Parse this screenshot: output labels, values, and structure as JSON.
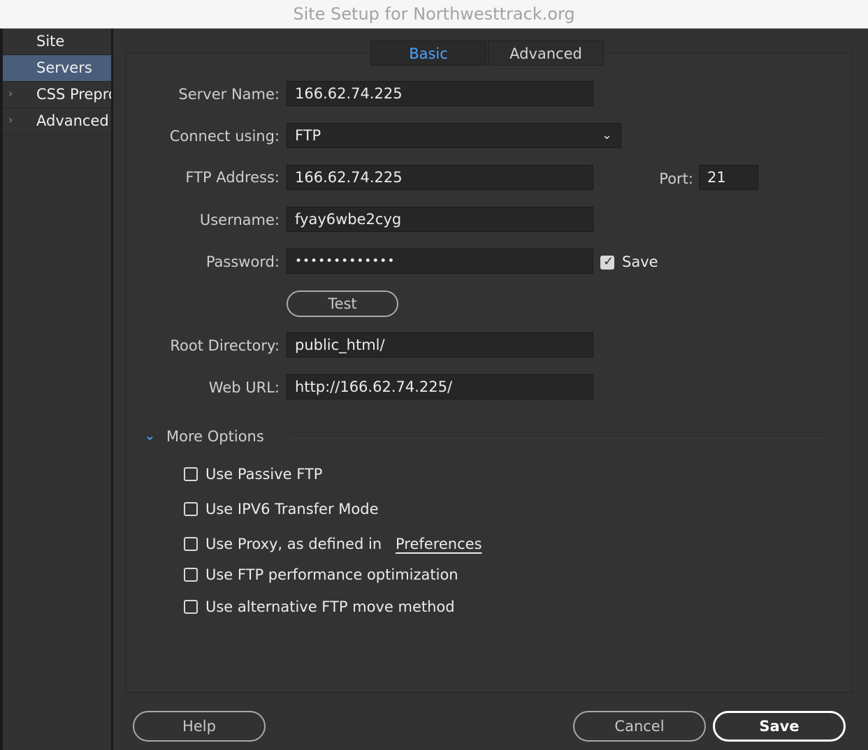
{
  "window": {
    "title": "Site Setup for Northwesttrack.org"
  },
  "sidebar": {
    "items": [
      {
        "label": "Site",
        "selected": false,
        "expandable": false
      },
      {
        "label": "Servers",
        "selected": true,
        "expandable": false
      },
      {
        "label": "CSS Prepro",
        "selected": false,
        "expandable": true
      },
      {
        "label": "Advanced",
        "selected": false,
        "expandable": true
      }
    ]
  },
  "tabs": [
    {
      "label": "Basic",
      "active": true
    },
    {
      "label": "Advanced",
      "active": false
    }
  ],
  "form": {
    "server_name": {
      "label": "Server Name:",
      "value": "166.62.74.225"
    },
    "connect_using": {
      "label": "Connect using:",
      "value": "FTP"
    },
    "ftp_address": {
      "label": "FTP Address:",
      "value": "166.62.74.225"
    },
    "port": {
      "label": "Port:",
      "value": "21"
    },
    "username": {
      "label": "Username:",
      "value": "fyay6wbe2cyg"
    },
    "password": {
      "label": "Password:",
      "value": "•••••••••••••",
      "save_label": "Save",
      "save_checked": true
    },
    "test_button": "Test",
    "root_directory": {
      "label": "Root Directory:",
      "value": "public_html/"
    },
    "web_url": {
      "label": "Web URL:",
      "value": "http://166.62.74.225/"
    }
  },
  "more_options": {
    "label": "More Options",
    "expanded": true,
    "options": [
      {
        "label": "Use Passive FTP",
        "checked": false
      },
      {
        "label": "Use IPV6 Transfer Mode",
        "checked": false
      },
      {
        "label": "Use Proxy, as defined in",
        "link": "Preferences",
        "checked": false
      },
      {
        "label": "Use FTP performance optimization",
        "checked": false
      },
      {
        "label": "Use alternative FTP move method",
        "checked": false
      }
    ]
  },
  "footer": {
    "help": "Help",
    "cancel": "Cancel",
    "save": "Save"
  },
  "colors": {
    "accent": "#4ea3ff",
    "selected_row": "#4a5d7a",
    "background": "#323232"
  }
}
